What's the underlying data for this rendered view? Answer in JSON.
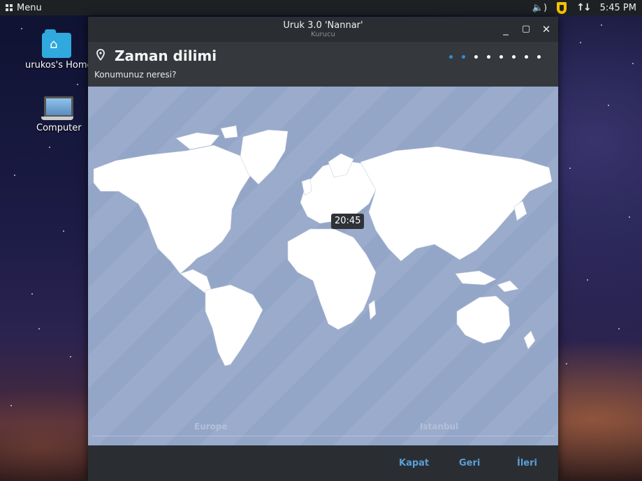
{
  "panel": {
    "menu_label": "Menu",
    "clock": "5:45 PM",
    "volume_icon": "speaker-icon",
    "shield_icon": "shield-icon",
    "network_icon": "up-down-arrows-icon"
  },
  "desktop": {
    "icons": [
      {
        "label": "urukos's Home",
        "icon": "home-folder-icon"
      },
      {
        "label": "Computer",
        "icon": "computer-icon"
      }
    ]
  },
  "window": {
    "title": "Uruk 3.0 'Nannar'",
    "subtitle": "Kurucu",
    "controls": [
      "minimize-icon",
      "maximize-icon",
      "close-icon"
    ]
  },
  "step": {
    "title": "Zaman dilimi",
    "subtitle": "Konumunuz neresi?",
    "icon": "location-pin-icon",
    "total_steps": 8,
    "current_step": 2
  },
  "map": {
    "tooltip_time": "20:45",
    "region_label": "Europe",
    "city_label": "Istanbul"
  },
  "footer": {
    "close_label": "Kapat",
    "back_label": "Geri",
    "next_label": "İleri"
  },
  "colors": {
    "accent": "#2f8fd6",
    "button_text": "#5a9fd8",
    "map_water": "#94a6c8",
    "land": "#ffffff"
  }
}
